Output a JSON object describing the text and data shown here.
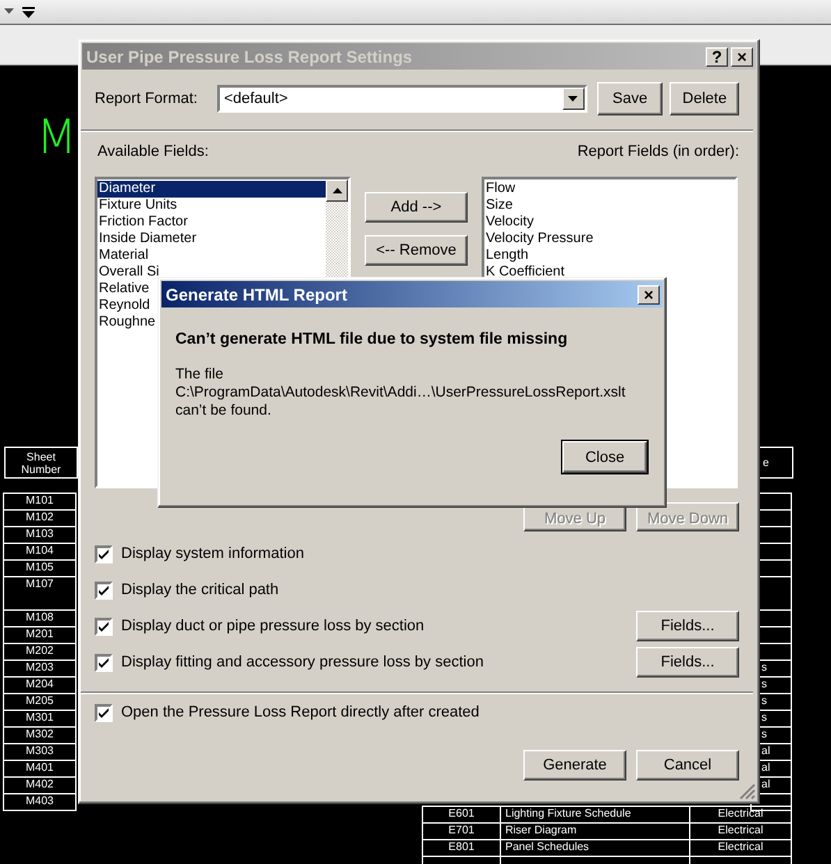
{
  "canvas": {
    "text": "M",
    "sheet_table": {
      "header": "Sheet Number",
      "rows": [
        {
          "number": "M101",
          "tall": false
        },
        {
          "number": "M102",
          "tall": false
        },
        {
          "number": "M103",
          "tall": false
        },
        {
          "number": "M104",
          "tall": false
        },
        {
          "number": "M105",
          "tall": false
        },
        {
          "number": "M107",
          "tall": true
        },
        {
          "number": "M108",
          "tall": false
        },
        {
          "number": "M201",
          "tall": false
        },
        {
          "number": "M202",
          "tall": false
        },
        {
          "number": "M203",
          "tall": false,
          "right_cell": "s"
        },
        {
          "number": "M204",
          "tall": false,
          "right_cell": "s"
        },
        {
          "number": "M205",
          "tall": false,
          "right_cell": "s"
        },
        {
          "number": "M301",
          "tall": false,
          "right_cell": "s"
        },
        {
          "number": "M302",
          "tall": false,
          "right_cell": "s"
        },
        {
          "number": "M303",
          "tall": false,
          "right_cell": "al"
        },
        {
          "number": "M401",
          "tall": false,
          "right_cell": "al"
        },
        {
          "number": "M402",
          "tall": false,
          "right_cell": "al"
        },
        {
          "number": "M403",
          "tall": false
        }
      ],
      "right_header": "e"
    },
    "bottom_table": {
      "rows": [
        {
          "number": "E601",
          "name": "Lighting Fixture Schedule",
          "discipline": "Electrical"
        },
        {
          "number": "E701",
          "name": "Riser Diagram",
          "discipline": "Electrical"
        },
        {
          "number": "E801",
          "name": "Panel Schedules",
          "discipline": "Electrical"
        }
      ]
    }
  },
  "settings_dialog": {
    "title": "User Pipe Pressure Loss Report Settings",
    "help": "?",
    "close": "×",
    "report_format": {
      "label": "Report Format:",
      "value": "<default>"
    },
    "save": "Save",
    "delete": "Delete",
    "available_label": "Available Fields:",
    "report_label": "Report Fields (in order):",
    "available_fields": [
      {
        "label": "Diameter",
        "selected": true
      },
      {
        "label": "Fixture Units",
        "selected": false
      },
      {
        "label": "Friction Factor",
        "selected": false
      },
      {
        "label": "Inside Diameter",
        "selected": false
      },
      {
        "label": "Material",
        "selected": false
      },
      {
        "label": "Overall Si",
        "selected": false
      },
      {
        "label": "Relative",
        "selected": false
      },
      {
        "label": "Reynold",
        "selected": false
      },
      {
        "label": "Roughne",
        "selected": false
      }
    ],
    "add": "Add -->",
    "remove": "<-- Remove",
    "report_fields": [
      {
        "label": "Flow",
        "selected": false
      },
      {
        "label": "Size",
        "selected": false
      },
      {
        "label": "Velocity",
        "selected": false
      },
      {
        "label": "Velocity Pressure",
        "selected": false
      },
      {
        "label": "Length",
        "selected": false
      },
      {
        "label": "K Coefficient",
        "selected": false
      }
    ],
    "move_up": {
      "label": "Move Up",
      "disabled": true
    },
    "move_down": {
      "label": "Move Down",
      "disabled": true
    },
    "options": [
      {
        "label": "Display system information",
        "checked": true
      },
      {
        "label": "Display the critical path",
        "checked": true
      },
      {
        "label": "Display duct or pipe pressure loss by section",
        "checked": true,
        "button": "Fields..."
      },
      {
        "label": "Display fitting and accessory pressure loss by section",
        "checked": true,
        "button": "Fields..."
      }
    ],
    "open_after": {
      "label": "Open the Pressure Loss Report directly after created",
      "checked": true
    },
    "generate": "Generate",
    "cancel": "Cancel"
  },
  "error_dialog": {
    "title": "Generate HTML Report",
    "close": "×",
    "heading": "Can’t generate HTML file due to system file missing",
    "lines": [
      "The file",
      "C:\\ProgramData\\Autodesk\\Revit\\Addi…\\UserPressureLossReport.xslt",
      "can’t be found."
    ],
    "button": "Close"
  }
}
